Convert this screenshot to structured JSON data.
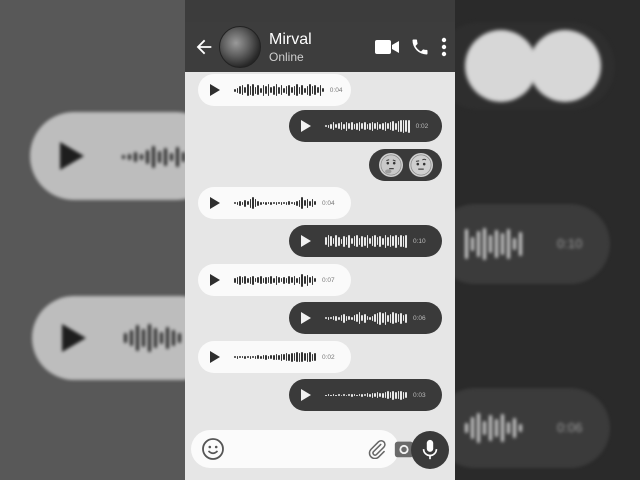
{
  "contact": {
    "name": "Mirval",
    "status": "Online"
  },
  "composer": {
    "placeholder": ""
  },
  "messages": [
    {
      "dir": "in",
      "duration": "0:04"
    },
    {
      "dir": "out",
      "duration": "0:02"
    },
    {
      "dir": "out",
      "type": "emoji",
      "emojis": [
        "thinking-face-icon",
        "raised-eyebrow-face-icon"
      ]
    },
    {
      "dir": "in",
      "duration": "0:04"
    },
    {
      "dir": "out",
      "duration": "0:10"
    },
    {
      "dir": "in",
      "duration": "0:07"
    },
    {
      "dir": "out",
      "duration": "0:06"
    },
    {
      "dir": "in",
      "duration": "0:02"
    },
    {
      "dir": "out",
      "duration": "0:03"
    }
  ],
  "background": {
    "left_duration": "",
    "right_durations": [
      "0:10",
      "0:06"
    ]
  },
  "icons": {
    "header": [
      "back-arrow-icon",
      "video-call-icon",
      "phone-icon",
      "more-options-icon"
    ],
    "composer": [
      "emoji-icon",
      "attach-icon",
      "camera-icon",
      "microphone-icon"
    ]
  },
  "colors": {
    "header": "#3d3d3d",
    "chat_bg": "#e6e6e6",
    "incoming": "#fafafa",
    "outgoing": "#3a3a3a"
  }
}
